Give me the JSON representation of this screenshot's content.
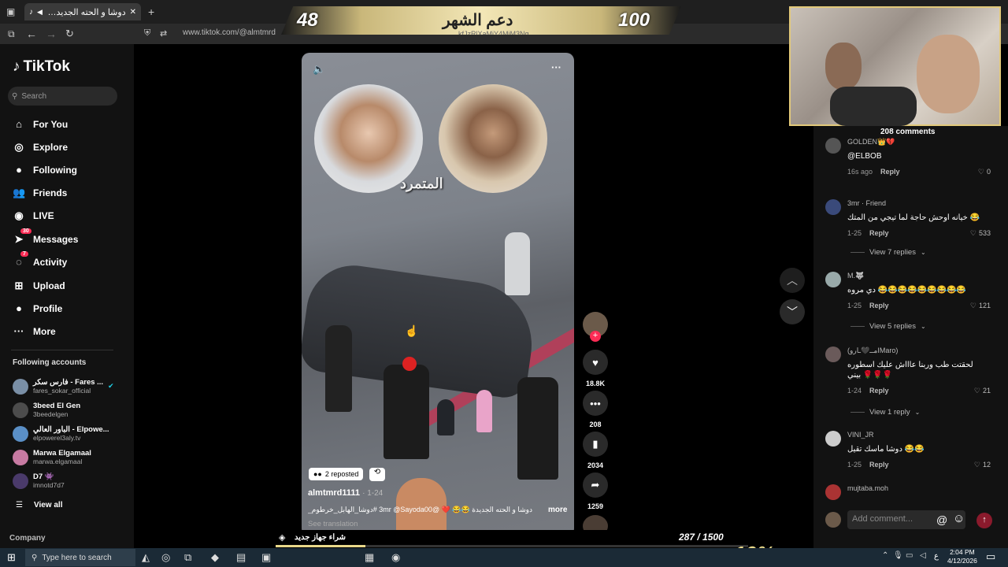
{
  "browser": {
    "tab_title": "دوشا و الحته الجديدة في كا",
    "tab_close": "✕",
    "new_tab": "+",
    "url_prefix": "www.tiktok.com/",
    "url_path": "@almtmrd"
  },
  "stream_overlay": {
    "left_number": "48",
    "label": "دعم الشهر",
    "right_number": "100",
    "sub_text": "kfJzRlXaMjY4MjM3Ng",
    "bottom_label": "شراء جهاز جديد",
    "progress_text": "287 / 1500",
    "percent": "19%",
    "progress_value": 0.19
  },
  "sidebar": {
    "logo": "TikTok",
    "search_placeholder": "Search",
    "nav": [
      {
        "label": "For You",
        "icon": "home-icon",
        "glyph": "⌂"
      },
      {
        "label": "Explore",
        "icon": "compass-icon",
        "glyph": "◎"
      },
      {
        "label": "Following",
        "icon": "following-avatar-icon",
        "glyph": "●"
      },
      {
        "label": "Friends",
        "icon": "friends-icon",
        "glyph": "👥"
      },
      {
        "label": "LIVE",
        "icon": "live-icon",
        "glyph": "◉"
      },
      {
        "label": "Messages",
        "icon": "messages-icon",
        "glyph": "➤",
        "badge": "30"
      },
      {
        "label": "Activity",
        "icon": "activity-icon",
        "glyph": "◌",
        "badge": "7"
      },
      {
        "label": "Upload",
        "icon": "upload-icon",
        "glyph": "⊞"
      },
      {
        "label": "Profile",
        "icon": "profile-avatar-icon",
        "glyph": "●"
      },
      {
        "label": "More",
        "icon": "more-icon",
        "glyph": "···"
      }
    ],
    "following_title": "Following accounts",
    "accounts": [
      {
        "name": "فارس سكر - Fares ...",
        "handle": "fares_sokar_official",
        "verified": true
      },
      {
        "name": "3beed El Gen",
        "handle": "3beedelgen"
      },
      {
        "name": "الباور العالي - Elpowe...",
        "handle": "elpowerel3aly.tv"
      },
      {
        "name": "Marwa Elgamaal",
        "handle": "marwa.elgamaal"
      },
      {
        "name": "D7 👾",
        "handle": "imnotd7d7"
      }
    ],
    "view_all": "View all",
    "company": "Company"
  },
  "video": {
    "watermark": "المتمرد",
    "reposted": "2 reposted",
    "author": "almtmrd1111",
    "date": "· 1-24",
    "caption": "دوشا و الحته الجديدة 😂😂 ❤️ @3mr @Sayoda00 #دوشا_الهابل_خرطوم_...",
    "more": "more",
    "see_translation": "See translation"
  },
  "actions": [
    {
      "name": "like",
      "count": "18.8K",
      "glyph": "♥"
    },
    {
      "name": "comment",
      "count": "208",
      "glyph": "•••"
    },
    {
      "name": "save",
      "count": "2034",
      "glyph": "▮"
    },
    {
      "name": "share",
      "count": "1259",
      "glyph": "➦"
    }
  ],
  "comments_panel": {
    "title": "208 comments",
    "items": [
      {
        "user": "GOLDEN👑💔",
        "text": "@ELBOB",
        "time": "16s ago",
        "reply": "Reply",
        "likes": "0"
      },
      {
        "user": "3mr · Friend",
        "text": "خيانه اوحش حاجة لما تيجي من المتك 😂",
        "time": "1-25",
        "reply": "Reply",
        "likes": "533"
      },
      {
        "user": "M.🐺",
        "text": "دي مروه 😂😂😂😂😂😂😂😂😂",
        "time": "1-25",
        "reply": "Reply",
        "likes": "121"
      },
      {
        "user": "(مــ🖤ـاروIMaro)",
        "text": "لحقتت طب وربنا عاااش عليك اسطوره",
        "text2": "بيني 🌹🌹🌹",
        "time": "1-24",
        "reply": "Reply",
        "likes": "21"
      },
      {
        "user": "VINI_JR",
        "text": "دوشا ماسك تقيل 😂😂",
        "time": "1-25",
        "reply": "Reply",
        "likes": "12"
      },
      {
        "user": "mujtaba.moh",
        "text": "",
        "time": "",
        "reply": "",
        "likes": ""
      }
    ],
    "view_replies": [
      "View 7 replies",
      "View 5 replies",
      "View 1 reply"
    ],
    "add_comment_placeholder": "Add comment...",
    "at": "@",
    "emoji": "☺"
  },
  "taskbar": {
    "search_placeholder": "Type here to search",
    "time": "2:04 PM",
    "date": "4/12/2026",
    "lang": "ع"
  },
  "colors": {
    "accent": "#fe2c55",
    "gold": "#e8d88a"
  }
}
